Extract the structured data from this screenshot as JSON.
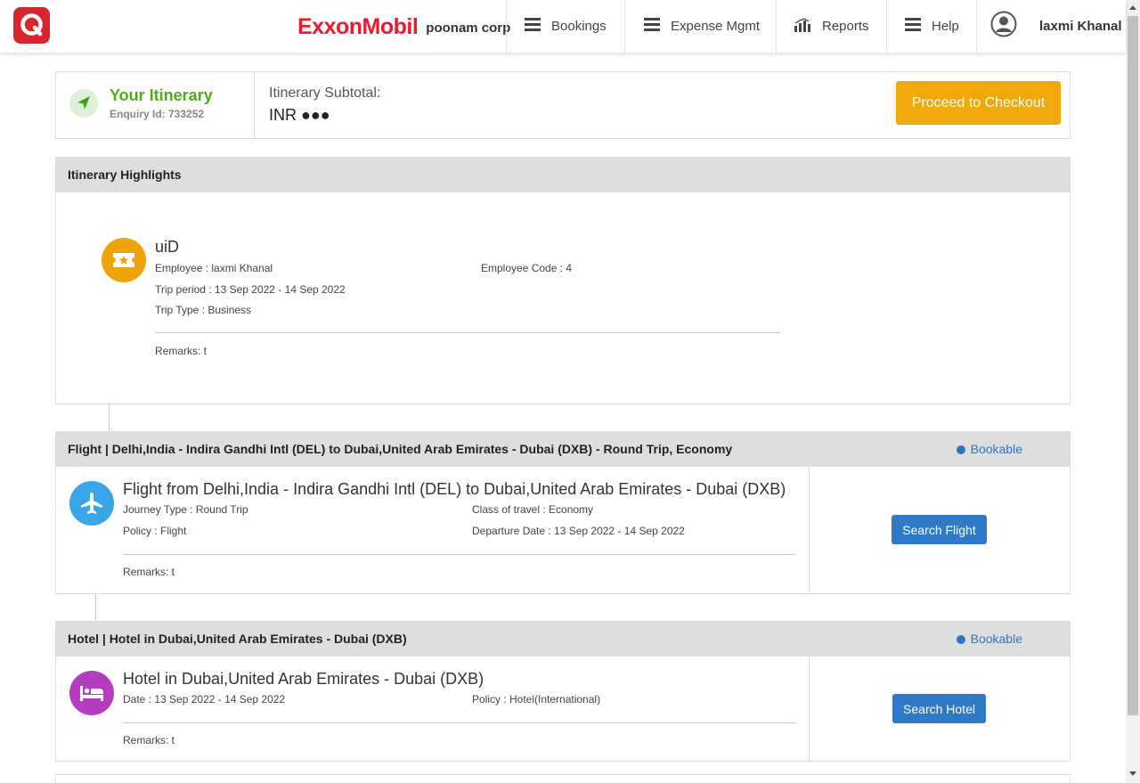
{
  "header": {
    "app_logo_icon": "q-logo-icon",
    "brand_name": "ExxonMobil",
    "corp_name": "poonam corp",
    "nav": [
      {
        "label": "Bookings",
        "icon": "hamburger-icon"
      },
      {
        "label": "Expense Mgmt",
        "icon": "hamburger-icon"
      },
      {
        "label": "Reports",
        "icon": "bar-chart-icon"
      },
      {
        "label": "Help",
        "icon": "hamburger-icon"
      }
    ],
    "user_name": "laxmi Khanal",
    "user_icon": "user-avatar-icon"
  },
  "summary": {
    "title": "Your Itinerary",
    "enquiry": "Enquiry Id: 733252",
    "subtotal_label": "Itinerary Subtotal:",
    "subtotal_value": "INR ●●●",
    "checkout_label": "Proceed to Checkout"
  },
  "highlights": {
    "header": "Itinerary Highlights",
    "title": "uiD",
    "employee": "Employee : laxmi Khanal",
    "employee_code": "Employee Code : 4",
    "trip_period": "Trip period : 13 Sep 2022 - 14 Sep 2022",
    "trip_type": "Trip Type : Business",
    "remarks": "Remarks: t"
  },
  "flight": {
    "header": "Flight | Delhi,India - Indira Gandhi Intl (DEL) to Dubai,United Arab Emirates - Dubai (DXB) - Round Trip, Economy",
    "status": "Bookable",
    "title": "Flight from Delhi,India - Indira Gandhi Intl (DEL) to Dubai,United Arab Emirates - Dubai (DXB)",
    "journey_type": "Journey Type : Round Trip",
    "class": "Class of travel : Economy",
    "policy": "Policy : Flight",
    "departure": "Departure Date : 13 Sep 2022 - 14 Sep 2022",
    "remarks": "Remarks: t",
    "button": "Search Flight"
  },
  "hotel": {
    "header": "Hotel | Hotel in Dubai,United Arab Emirates - Dubai (DXB)",
    "status": "Bookable",
    "title": "Hotel in Dubai,United Arab Emirates - Dubai (DXB)",
    "date": "Date : 13 Sep 2022 - 14 Sep 2022",
    "policy": "Policy : Hotel(International)",
    "remarks": "Remarks: t",
    "button": "Search Hotel"
  },
  "colors": {
    "brand_red": "#ed1b2f",
    "accent_green": "#4caf1a",
    "checkout_orange": "#f0a80c",
    "primary_blue": "#3079c7",
    "flight_icon_bg": "#3aa6e8",
    "hotel_icon_bg": "#b63cc1",
    "highlight_icon_bg": "#efa30d"
  }
}
